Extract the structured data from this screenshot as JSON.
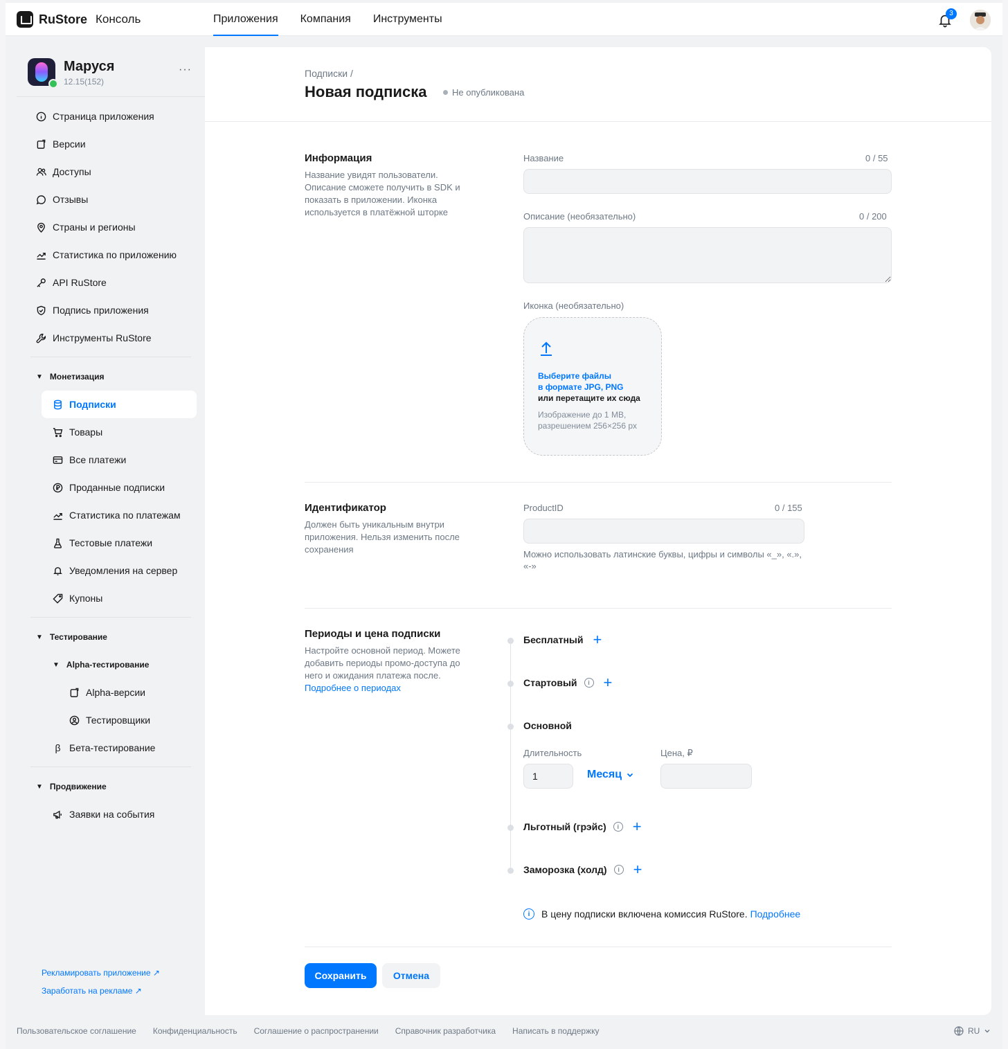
{
  "header": {
    "logo_name": "RuStore",
    "logo_sub": "Консоль",
    "tabs": [
      {
        "label": "Приложения",
        "active": true
      },
      {
        "label": "Компания",
        "active": false
      },
      {
        "label": "Инструменты",
        "active": false
      }
    ],
    "notifications_count": "3"
  },
  "app": {
    "name": "Маруся",
    "version": "12.15(152)",
    "more": "···"
  },
  "sidebar": {
    "items": [
      {
        "label": "Страница приложения",
        "icon": "info-icon"
      },
      {
        "label": "Версии",
        "icon": "versions-icon"
      },
      {
        "label": "Доступы",
        "icon": "users-icon"
      },
      {
        "label": "Отзывы",
        "icon": "comment-icon"
      },
      {
        "label": "Страны и регионы",
        "icon": "location-icon"
      },
      {
        "label": "Статистика по приложению",
        "icon": "chart-icon"
      },
      {
        "label": "API RuStore",
        "icon": "key-icon"
      },
      {
        "label": "Подпись приложения",
        "icon": "shield-icon"
      },
      {
        "label": "Инструменты RuStore",
        "icon": "wrench-icon"
      }
    ],
    "monetization": {
      "label": "Монетизация",
      "items": [
        {
          "label": "Подписки",
          "icon": "database-icon",
          "active": true
        },
        {
          "label": "Товары",
          "icon": "cart-icon"
        },
        {
          "label": "Все платежи",
          "icon": "card-icon"
        },
        {
          "label": "Проданные подписки",
          "icon": "ruble-icon"
        },
        {
          "label": "Статистика по платежам",
          "icon": "chart-icon"
        },
        {
          "label": "Тестовые платежи",
          "icon": "flask-icon"
        },
        {
          "label": "Уведомления на сервер",
          "icon": "bell-sync-icon"
        },
        {
          "label": "Купоны",
          "icon": "coupon-icon"
        }
      ]
    },
    "testing": {
      "label": "Тестирование",
      "alpha": {
        "label": "Alpha-тестирование",
        "items": [
          {
            "label": "Alpha-версии",
            "icon": "versions-icon"
          },
          {
            "label": "Тестировщики",
            "icon": "person-icon"
          }
        ]
      },
      "beta": {
        "label": "Бета-тестирование",
        "icon": "beta-icon"
      }
    },
    "promotion": {
      "label": "Продвижение",
      "items": [
        {
          "label": "Заявки на события",
          "icon": "megaphone-icon"
        }
      ]
    },
    "links": [
      {
        "label": "Рекламировать приложение ↗"
      },
      {
        "label": "Заработать на рекламе ↗"
      }
    ]
  },
  "page": {
    "breadcrumb": "Подписки   /",
    "title": "Новая подписка",
    "status": "Не опубликована"
  },
  "info_section": {
    "title": "Информация",
    "description": "Название увидят пользователи. Описание сможете получить в SDK и показать в приложении. Иконка используется в платёжной шторке",
    "name_label": "Название",
    "name_counter": "0 / 55",
    "name_value": "",
    "desc_label": "Описание (необязательно)",
    "desc_counter": "0 / 200",
    "desc_value": "",
    "icon_label": "Иконка (необязательно)",
    "upload_line1": "Выберите файлы",
    "upload_line2": "в формате JPG, PNG",
    "upload_line3": "или перетащите их сюда",
    "upload_hint": "Изображение до 1 MB, разрешением 256×256 px"
  },
  "id_section": {
    "title": "Идентификатор",
    "description": "Должен быть уникальным внутри приложения. Нельзя изменить после сохранения",
    "field_label": "ProductID",
    "counter": "0 / 155",
    "value": "",
    "hint": "Можно использовать латинские буквы, цифры и символы «_», «.», «-»"
  },
  "periods_section": {
    "title": "Периоды и цена подписки",
    "description": "Настройте основной период. Можете добавить периоды промо-доступа до него и ожидания платежа после.",
    "link": "Подробнее о периодах",
    "periods": [
      {
        "label": "Бесплатный",
        "info": false,
        "add": true
      },
      {
        "label": "Стартовый",
        "info": true,
        "add": true
      },
      {
        "label": "Основной",
        "info": false,
        "add": false
      },
      {
        "label": "Льготный (грэйс)",
        "info": true,
        "add": true
      },
      {
        "label": "Заморозка (холд)",
        "info": true,
        "add": true
      }
    ],
    "duration_label": "Длительность",
    "duration_value": "1",
    "duration_unit": "Месяц",
    "price_label": "Цена, ₽",
    "price_value": "",
    "note_text": "В цену подписки включена комиссия RuStore.",
    "note_link": "Подробнее"
  },
  "actions": {
    "save": "Сохранить",
    "cancel": "Отмена"
  },
  "footer": {
    "links": [
      "Пользовательское соглашение",
      "Конфиденциальность",
      "Соглашение о распространении",
      "Справочник разработчика",
      "Написать в поддержку"
    ],
    "lang": "RU"
  },
  "colors": {
    "accent": "#0077ff",
    "online": "#35c15a"
  }
}
